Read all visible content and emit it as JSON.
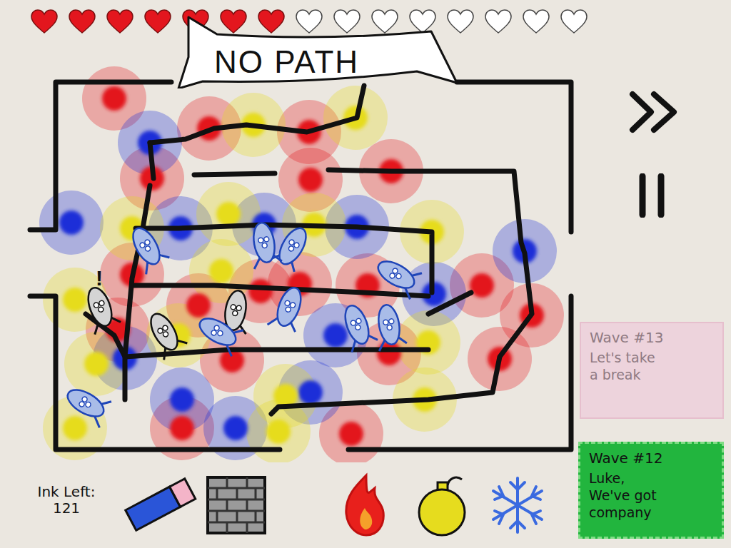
{
  "hearts": [
    {
      "filled": true
    },
    {
      "filled": true
    },
    {
      "filled": true
    },
    {
      "filled": true
    },
    {
      "filled": true
    },
    {
      "filled": true
    },
    {
      "filled": true
    },
    {
      "filled": false
    },
    {
      "filled": false
    },
    {
      "filled": false
    },
    {
      "filled": false
    },
    {
      "filled": false
    },
    {
      "filled": false
    },
    {
      "filled": false
    },
    {
      "filled": false
    }
  ],
  "banner": {
    "text": "NO PATH"
  },
  "ink": {
    "label": "Ink Left:",
    "value": "121"
  },
  "tools": [
    {
      "kind": "eraser"
    },
    {
      "kind": "wall"
    },
    {
      "kind": "fire"
    },
    {
      "kind": "bomb"
    },
    {
      "kind": "ice"
    }
  ],
  "waves": [
    {
      "title": "Wave #13",
      "lines": [
        "Let's take",
        "a break"
      ],
      "current": false
    },
    {
      "title": "Wave #12",
      "lines": [
        "Luke,",
        "We've got",
        "company"
      ],
      "current": true
    }
  ],
  "towers": [
    {
      "kind": "fire",
      "color": "#e3181e"
    },
    {
      "kind": "fire",
      "color": "#e3181e"
    },
    {
      "kind": "fire",
      "color": "#e3181e"
    },
    {
      "kind": "fire",
      "color": "#e3181e"
    },
    {
      "kind": "fire",
      "color": "#e3181e"
    },
    {
      "kind": "fire",
      "color": "#e3181e"
    },
    {
      "kind": "fire",
      "color": "#e3181e"
    },
    {
      "kind": "fire",
      "color": "#e3181e"
    },
    {
      "kind": "fire",
      "color": "#e3181e"
    },
    {
      "kind": "fire",
      "color": "#e3181e"
    },
    {
      "kind": "fire",
      "color": "#e3181e"
    },
    {
      "kind": "fire",
      "color": "#e3181e"
    },
    {
      "kind": "fire",
      "color": "#e3181e"
    },
    {
      "kind": "fire",
      "color": "#e3181e"
    },
    {
      "kind": "fire",
      "color": "#e3181e"
    },
    {
      "kind": "fire",
      "color": "#e3181e"
    },
    {
      "kind": "fire",
      "color": "#e3181e"
    },
    {
      "kind": "fire",
      "color": "#e3181e"
    },
    {
      "kind": "fire",
      "color": "#e3181e"
    },
    {
      "kind": "ice",
      "color": "#1c2fd8"
    },
    {
      "kind": "ice",
      "color": "#1c2fd8"
    },
    {
      "kind": "ice",
      "color": "#1c2fd8"
    },
    {
      "kind": "ice",
      "color": "#1c2fd8"
    },
    {
      "kind": "ice",
      "color": "#1c2fd8"
    },
    {
      "kind": "ice",
      "color": "#1c2fd8"
    },
    {
      "kind": "ice",
      "color": "#1c2fd8"
    },
    {
      "kind": "ice",
      "color": "#1c2fd8"
    },
    {
      "kind": "ice",
      "color": "#1c2fd8"
    },
    {
      "kind": "ice",
      "color": "#1c2fd8"
    },
    {
      "kind": "ice",
      "color": "#1c2fd8"
    },
    {
      "kind": "ice",
      "color": "#1c2fd8"
    },
    {
      "kind": "bomb",
      "color": "#e6dc1e"
    },
    {
      "kind": "bomb",
      "color": "#e6dc1e"
    },
    {
      "kind": "bomb",
      "color": "#e6dc1e"
    },
    {
      "kind": "bomb",
      "color": "#e6dc1e"
    },
    {
      "kind": "bomb",
      "color": "#e6dc1e"
    },
    {
      "kind": "bomb",
      "color": "#e6dc1e"
    },
    {
      "kind": "bomb",
      "color": "#e6dc1e"
    },
    {
      "kind": "bomb",
      "color": "#e6dc1e"
    },
    {
      "kind": "bomb",
      "color": "#e6dc1e"
    },
    {
      "kind": "bomb",
      "color": "#e6dc1e"
    },
    {
      "kind": "bomb",
      "color": "#e6dc1e"
    },
    {
      "kind": "bomb",
      "color": "#e6dc1e"
    },
    {
      "kind": "bomb",
      "color": "#e6dc1e"
    },
    {
      "kind": "bomb",
      "color": "#e6dc1e"
    },
    {
      "kind": "bomb",
      "color": "#e6dc1e"
    }
  ],
  "enemies": [
    {
      "kind": "blue",
      "mark": ""
    },
    {
      "kind": "dark",
      "mark": "!"
    },
    {
      "kind": "dark",
      "mark": ""
    },
    {
      "kind": "dark",
      "mark": ""
    },
    {
      "kind": "blue",
      "mark": ""
    },
    {
      "kind": "blue",
      "mark": ""
    },
    {
      "kind": "blue",
      "mark": ""
    },
    {
      "kind": "blue",
      "mark": ""
    },
    {
      "kind": "blue",
      "mark": ""
    },
    {
      "kind": "blue",
      "mark": ""
    },
    {
      "kind": "blue",
      "mark": ""
    },
    {
      "kind": "blue",
      "mark": ""
    }
  ]
}
